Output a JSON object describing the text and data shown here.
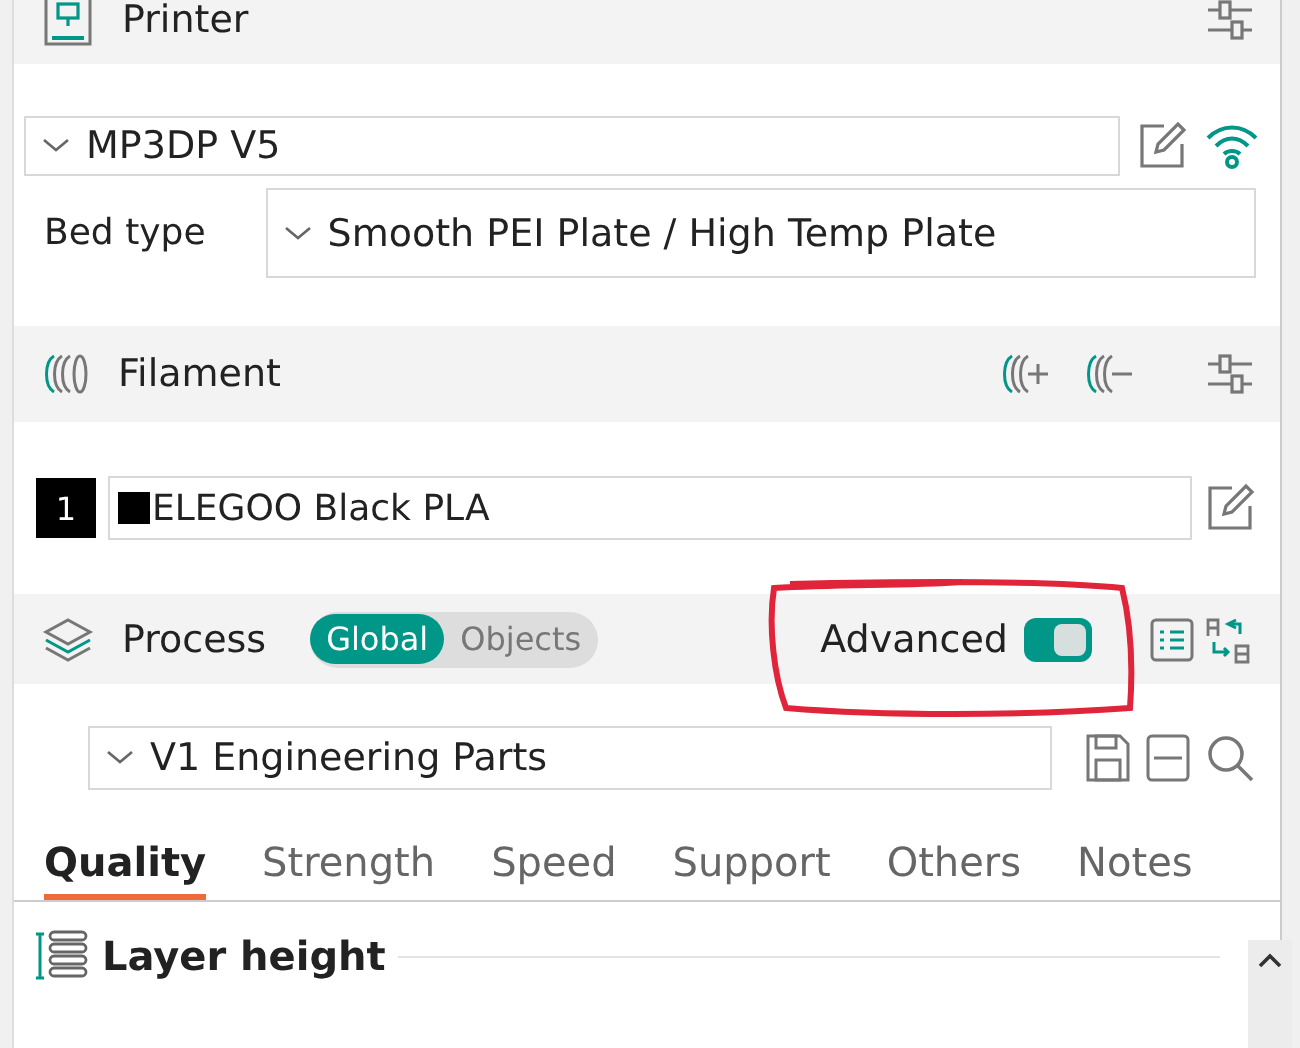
{
  "printer": {
    "title": "Printer",
    "preset": "MP3DP V5",
    "bed_type_label": "Bed type",
    "bed_type": "Smooth PEI Plate / High Temp Plate"
  },
  "filament": {
    "title": "Filament",
    "items": [
      {
        "index": "1",
        "color": "#000000",
        "name": "ELEGOO Black PLA"
      }
    ]
  },
  "process": {
    "title": "Process",
    "scope": [
      {
        "label": "Global",
        "selected": true
      },
      {
        "label": "Objects",
        "selected": false
      }
    ],
    "advanced_label": "Advanced",
    "advanced": true,
    "preset": "V1 Engineering Parts",
    "tabs": [
      {
        "label": "Quality",
        "selected": true
      },
      {
        "label": "Strength",
        "selected": false
      },
      {
        "label": "Speed",
        "selected": false
      },
      {
        "label": "Support",
        "selected": false
      },
      {
        "label": "Others",
        "selected": false
      },
      {
        "label": "Notes",
        "selected": false
      }
    ],
    "section": {
      "title": "Layer height"
    }
  }
}
